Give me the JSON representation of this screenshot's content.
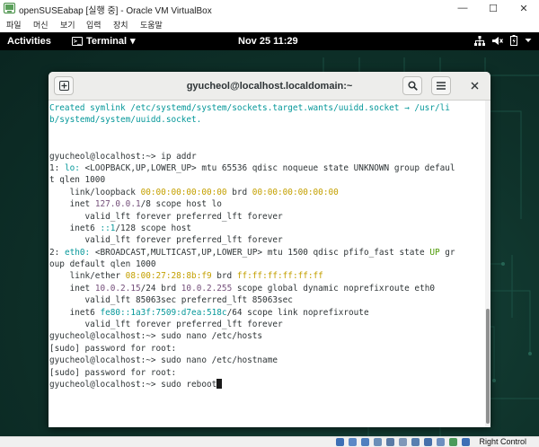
{
  "vbox_window": {
    "title": "openSUSEabap [실행 중] - Oracle VM VirtualBox",
    "minimize_glyph": "—",
    "maximize_glyph": "☐",
    "close_glyph": "✕",
    "menu": [
      "파일",
      "머신",
      "보기",
      "입력",
      "장치",
      "도움말"
    ]
  },
  "gnome_topbar": {
    "activities": "Activities",
    "app_menu": "Terminal",
    "app_menu_arrow": "▾",
    "terminal_glyph": ">_",
    "datetime": "Nov 25  11:29",
    "status_icons": [
      "network-icon",
      "volume-icon",
      "battery-icon",
      "power-menu-icon"
    ]
  },
  "terminal": {
    "title": "gyucheol@localhost.localdomain:~",
    "new_tab_glyph": "⊞",
    "search_glyph": "🔍",
    "menu_glyph": "≡",
    "lines": [
      [
        {
          "t": "Created symlink /etc/systemd/system/sockets.target.wants/uuidd.socket → /usr/li",
          "c": "cyan"
        }
      ],
      [
        {
          "t": "b/systemd/system/uuidd.socket.",
          "c": "cyan"
        }
      ],
      [
        {
          "t": ""
        }
      ],
      [
        {
          "t": ""
        }
      ],
      [
        {
          "t": "gyucheol@localhost:~> ip addr"
        }
      ],
      [
        {
          "t": "1: "
        },
        {
          "t": "lo:",
          "c": "cyan"
        },
        {
          "t": " <LOOPBACK,UP,LOWER_UP> mtu 65536 qdisc noqueue state UNKNOWN group defaul"
        }
      ],
      [
        {
          "t": "t qlen 1000"
        }
      ],
      [
        {
          "t": "    link/loopback "
        },
        {
          "t": "00:00:00:00:00:00",
          "c": "yellow"
        },
        {
          "t": " brd "
        },
        {
          "t": "00:00:00:00:00:00",
          "c": "yellow"
        }
      ],
      [
        {
          "t": "    inet "
        },
        {
          "t": "127.0.0.1",
          "c": "magenta"
        },
        {
          "t": "/8 scope host lo"
        }
      ],
      [
        {
          "t": "       valid_lft forever preferred_lft forever"
        }
      ],
      [
        {
          "t": "    inet6 "
        },
        {
          "t": "::1",
          "c": "cyan"
        },
        {
          "t": "/128 scope host"
        }
      ],
      [
        {
          "t": "       valid_lft forever preferred_lft forever"
        }
      ],
      [
        {
          "t": "2: "
        },
        {
          "t": "eth0:",
          "c": "cyan"
        },
        {
          "t": " <BROADCAST,MULTICAST,UP,LOWER_UP> mtu 1500 qdisc pfifo_fast state "
        },
        {
          "t": "UP",
          "c": "green"
        },
        {
          "t": " gr"
        }
      ],
      [
        {
          "t": "oup default qlen 1000"
        }
      ],
      [
        {
          "t": "    link/ether "
        },
        {
          "t": "08:00:27:28:8b:f9",
          "c": "yellow"
        },
        {
          "t": " brd "
        },
        {
          "t": "ff:ff:ff:ff:ff:ff",
          "c": "yellow"
        }
      ],
      [
        {
          "t": "    inet "
        },
        {
          "t": "10.0.2.15",
          "c": "magenta"
        },
        {
          "t": "/24 brd "
        },
        {
          "t": "10.0.2.255",
          "c": "magenta"
        },
        {
          "t": " scope global dynamic noprefixroute eth0"
        }
      ],
      [
        {
          "t": "       valid_lft 85063sec preferred_lft 85063sec"
        }
      ],
      [
        {
          "t": "    inet6 "
        },
        {
          "t": "fe80::1a3f:7509:d7ea:518c",
          "c": "cyan"
        },
        {
          "t": "/64 scope link noprefixroute"
        }
      ],
      [
        {
          "t": "       valid_lft forever preferred_lft forever"
        }
      ],
      [
        {
          "t": "gyucheol@localhost:~> sudo nano /etc/hosts"
        }
      ],
      [
        {
          "t": "[sudo] password for root:"
        }
      ],
      [
        {
          "t": "gyucheol@localhost:~> sudo nano /etc/hostname"
        }
      ],
      [
        {
          "t": "[sudo] password for root:"
        }
      ],
      [
        {
          "t": "gyucheol@localhost:~> sudo reboot"
        },
        {
          "cursor": true
        }
      ]
    ]
  },
  "vbox_status": {
    "host_key": "Right Control"
  }
}
